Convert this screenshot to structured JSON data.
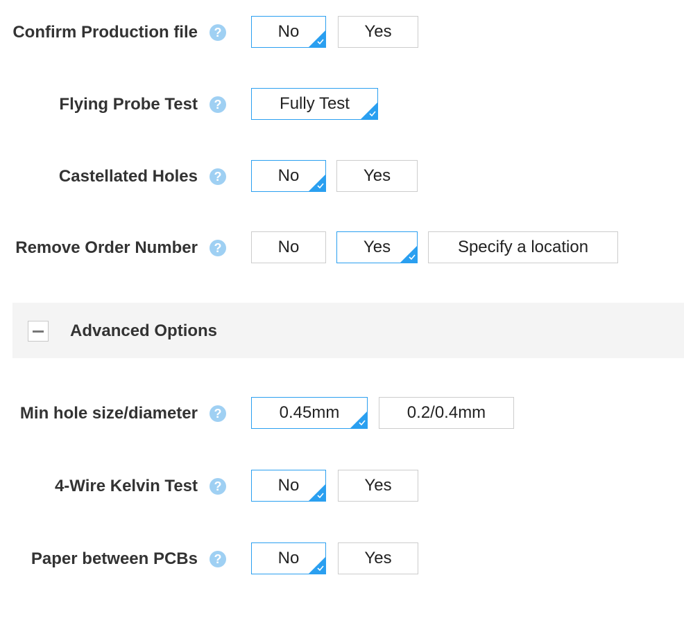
{
  "help_glyph": "?",
  "accent_color": "#2a9ff0",
  "rows": {
    "confirm": {
      "label": "Confirm Production file",
      "options": [
        "No",
        "Yes"
      ],
      "selected": "No"
    },
    "flying": {
      "label": "Flying Probe Test",
      "options": [
        "Fully Test"
      ],
      "selected": "Fully Test"
    },
    "castellated": {
      "label": "Castellated Holes",
      "options": [
        "No",
        "Yes"
      ],
      "selected": "No"
    },
    "remove": {
      "label": "Remove Order Number",
      "options": [
        "No",
        "Yes",
        "Specify a location"
      ],
      "selected": "Yes"
    },
    "minhole": {
      "label": "Min hole size/diameter",
      "options": [
        "0.45mm",
        "0.2/0.4mm"
      ],
      "selected": "0.45mm"
    },
    "kelvin": {
      "label": "4-Wire Kelvin Test",
      "options": [
        "No",
        "Yes"
      ],
      "selected": "No"
    },
    "paper": {
      "label": "Paper between PCBs",
      "options": [
        "No",
        "Yes"
      ],
      "selected": "No"
    }
  },
  "advanced": {
    "label": "Advanced Options",
    "expanded": true,
    "toggle_icon": "minus-icon"
  }
}
